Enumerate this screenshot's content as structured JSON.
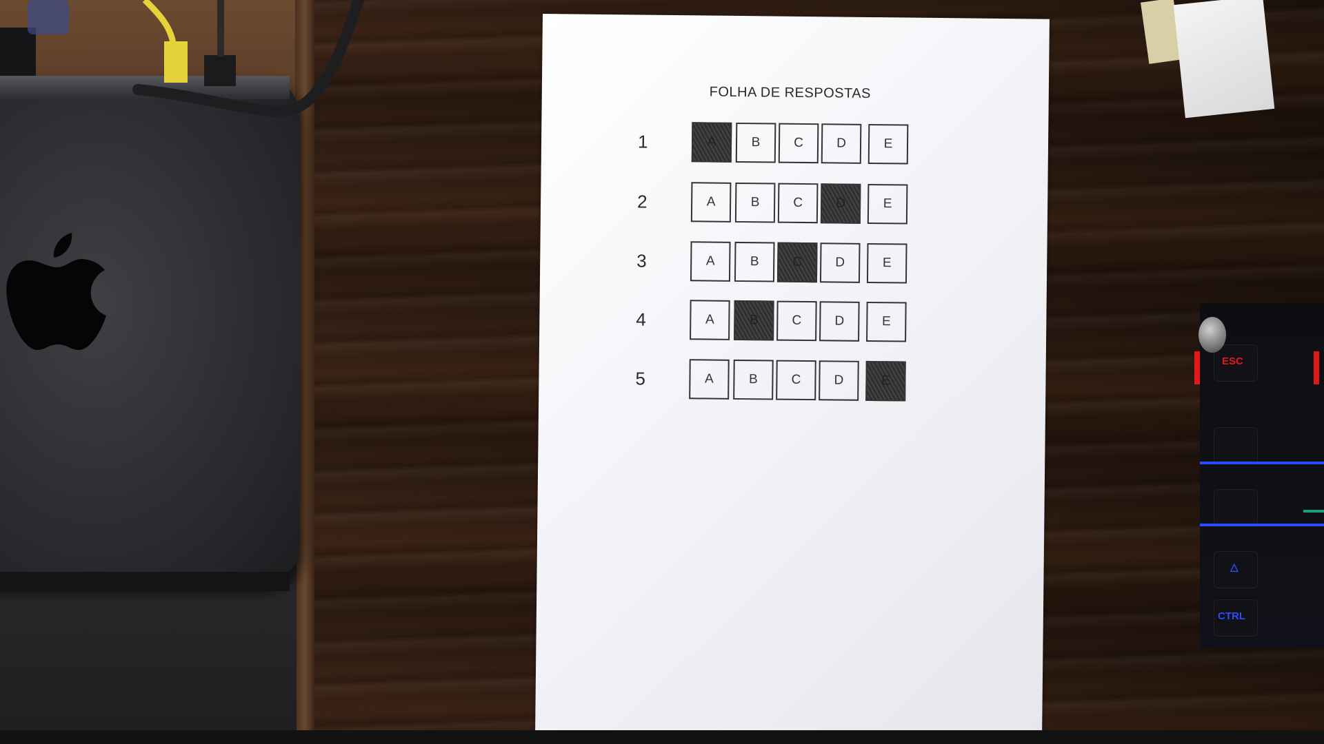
{
  "answer_sheet": {
    "title": "FOLHA DE RESPOSTAS",
    "questions": [
      {
        "number": "1",
        "options": [
          "A",
          "B",
          "C",
          "D",
          "E"
        ],
        "marked": "A"
      },
      {
        "number": "2",
        "options": [
          "A",
          "B",
          "C",
          "D",
          "E"
        ],
        "marked": "D"
      },
      {
        "number": "3",
        "options": [
          "A",
          "B",
          "C",
          "D",
          "E"
        ],
        "marked": "C"
      },
      {
        "number": "4",
        "options": [
          "A",
          "B",
          "C",
          "D",
          "E"
        ],
        "marked": "B"
      },
      {
        "number": "5",
        "options": [
          "A",
          "B",
          "C",
          "D",
          "E"
        ],
        "marked": "E"
      }
    ]
  },
  "keyboard": {
    "esc_key": "ESC",
    "ctrl_key": "CTRL"
  },
  "colors": {
    "paper": "#f3f4f8",
    "ink": "#333333",
    "desk_wood": "#2e1c12",
    "device_body": "#2f3034",
    "key_red": "#e01a1a",
    "key_blue": "#2a4cff",
    "cable_yellow": "#e8d23a"
  },
  "icons": {
    "device_logo": "apple-logo-icon"
  }
}
